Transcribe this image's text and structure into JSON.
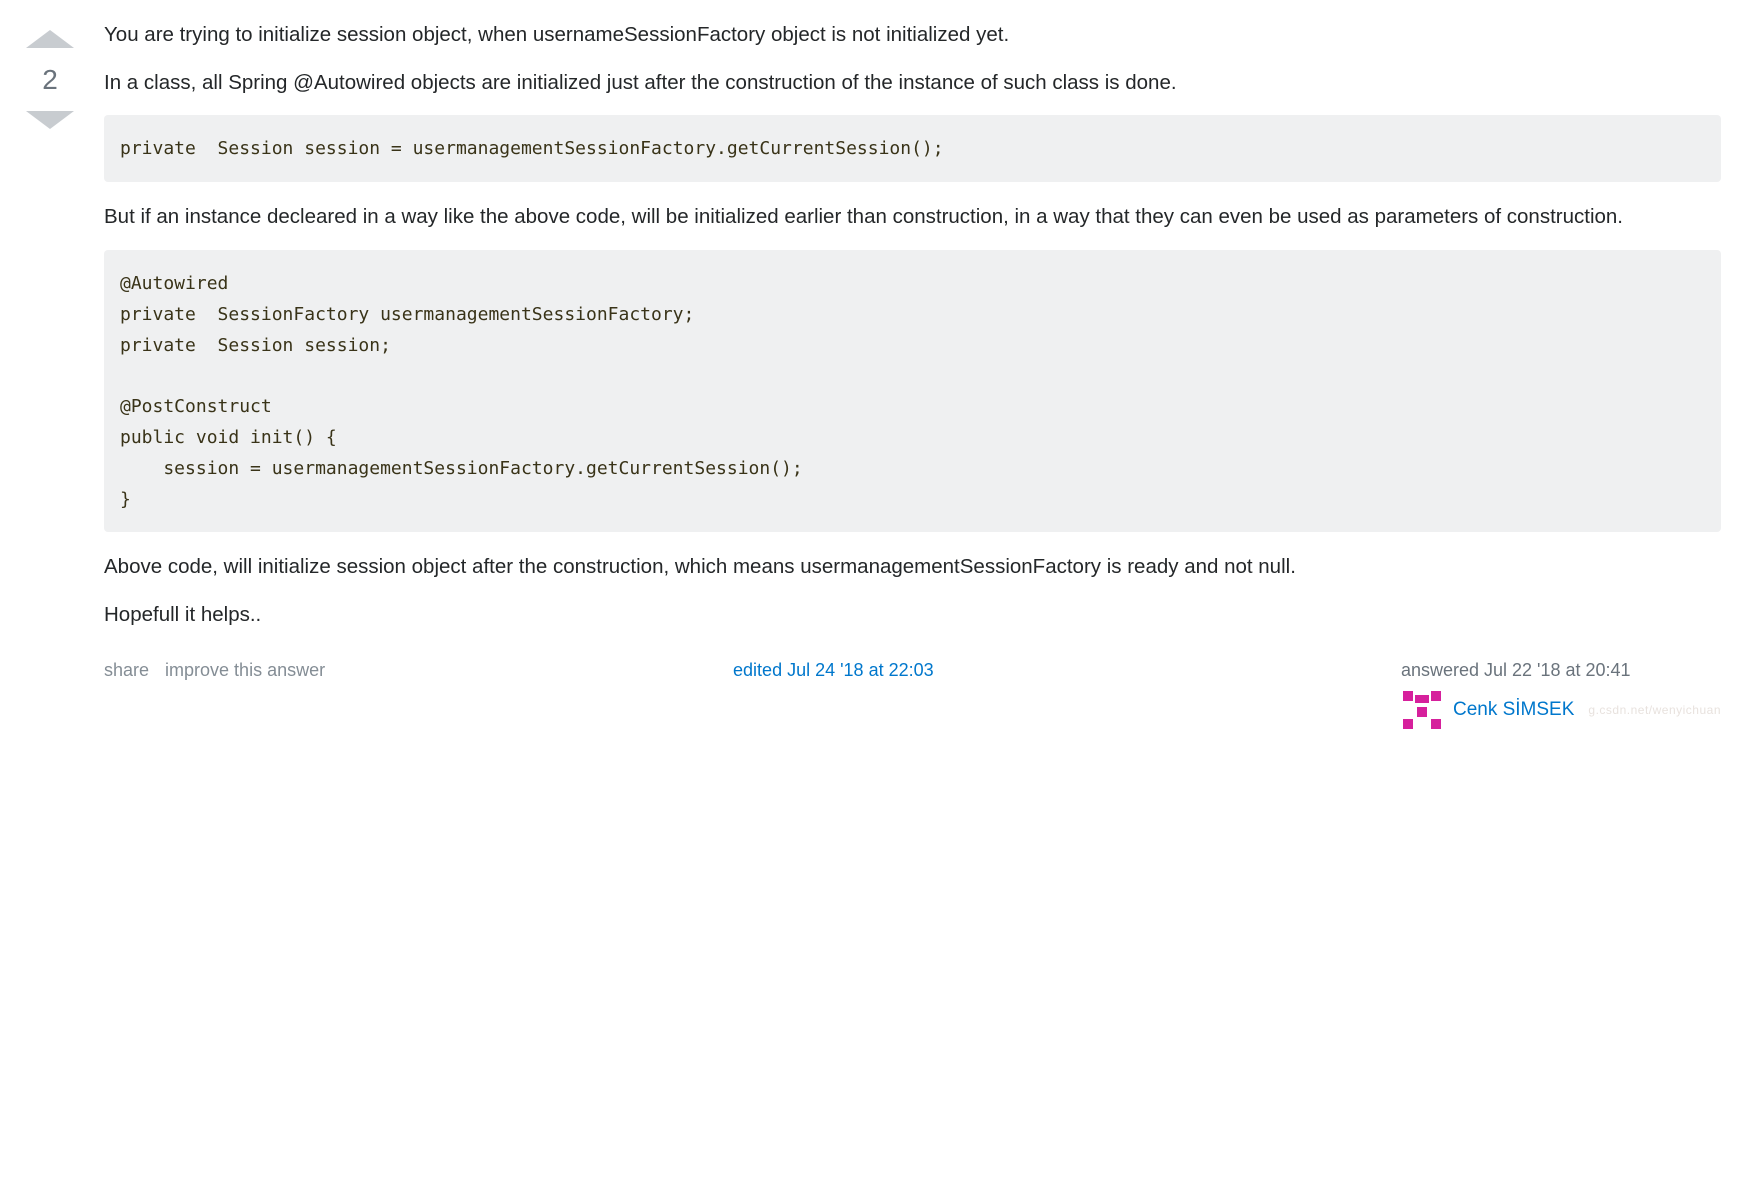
{
  "vote": {
    "count": "2"
  },
  "post": {
    "p1": "You are trying to initialize session object, when usernameSessionFactory object is not initialized yet.",
    "p2": "In a class, all Spring @Autowired objects are initialized just after the construction of the instance of such class is done.",
    "code1": "private  Session session = usermanagementSessionFactory.getCurrentSession();",
    "p3": "But if an instance decleared in a way like the above code, will be initialized earlier than construction, in a way that they can even be used as parameters of construction.",
    "code2": "@Autowired\nprivate  SessionFactory usermanagementSessionFactory;\nprivate  Session session;\n\n@PostConstruct\npublic void init() {\n    session = usermanagementSessionFactory.getCurrentSession();\n}",
    "p4": "Above code, will initialize session object after the construction, which means usermanagementSessionFactory is ready and not null.",
    "p5": "Hopefull it helps.."
  },
  "menu": {
    "share": "share",
    "improve": "improve this answer"
  },
  "edited": {
    "label": "edited Jul 24 '18 at 22:03"
  },
  "answered": {
    "label": "answered Jul 22 '18 at 20:41",
    "user": "Cenk SİMSEK"
  },
  "watermark": "g.csdn.net/wenyichuan"
}
